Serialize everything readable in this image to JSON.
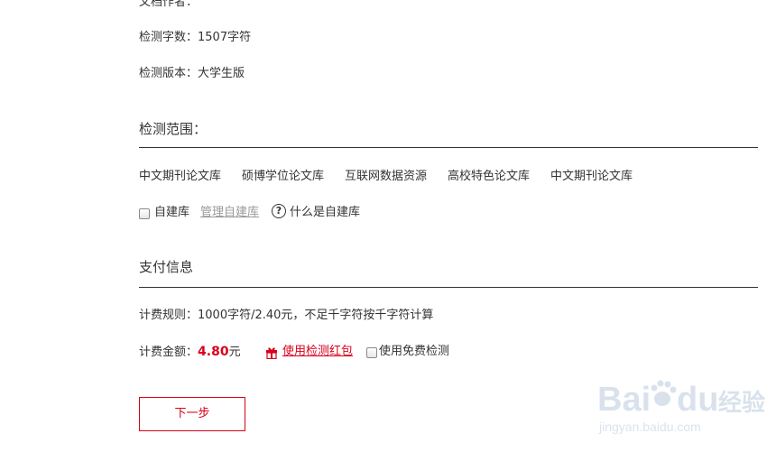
{
  "doc_info": {
    "author_label": "文档作者：",
    "word_count_label": "检测字数：1507字符",
    "version_label": "检测版本：大学生版"
  },
  "scope": {
    "title": "检测范围：",
    "databases": [
      "中文期刊论文库",
      "硕博学位论文库",
      "互联网数据资源",
      "高校特色论文库",
      "中文期刊论文库"
    ],
    "self_library_label": "自建库",
    "manage_link": "管理自建库",
    "help_icon_glyph": "?",
    "what_is_label": "什么是自建库"
  },
  "payment": {
    "title": "支付信息",
    "rule_label": "计费规则：1000字符/2.40元，不足千字符按千字符计算",
    "amount_label": "计费金额：",
    "amount_value": "4.80",
    "amount_unit": "元",
    "redpacket_link": "使用检测红包",
    "free_check_label": "使用免费检测"
  },
  "actions": {
    "next_label": "下一步"
  },
  "watermark": {
    "brand_text": "Bai",
    "brand_text2": "du",
    "cn_text": "经验",
    "url_text": "jingyan.baidu.com"
  },
  "colors": {
    "accent": "#d9001b",
    "text": "#333333",
    "link_grey": "#999999",
    "divider": "#333333"
  },
  "icons": {
    "help": "help-circle-icon",
    "gift": "gift-icon",
    "paw": "paw-icon"
  }
}
